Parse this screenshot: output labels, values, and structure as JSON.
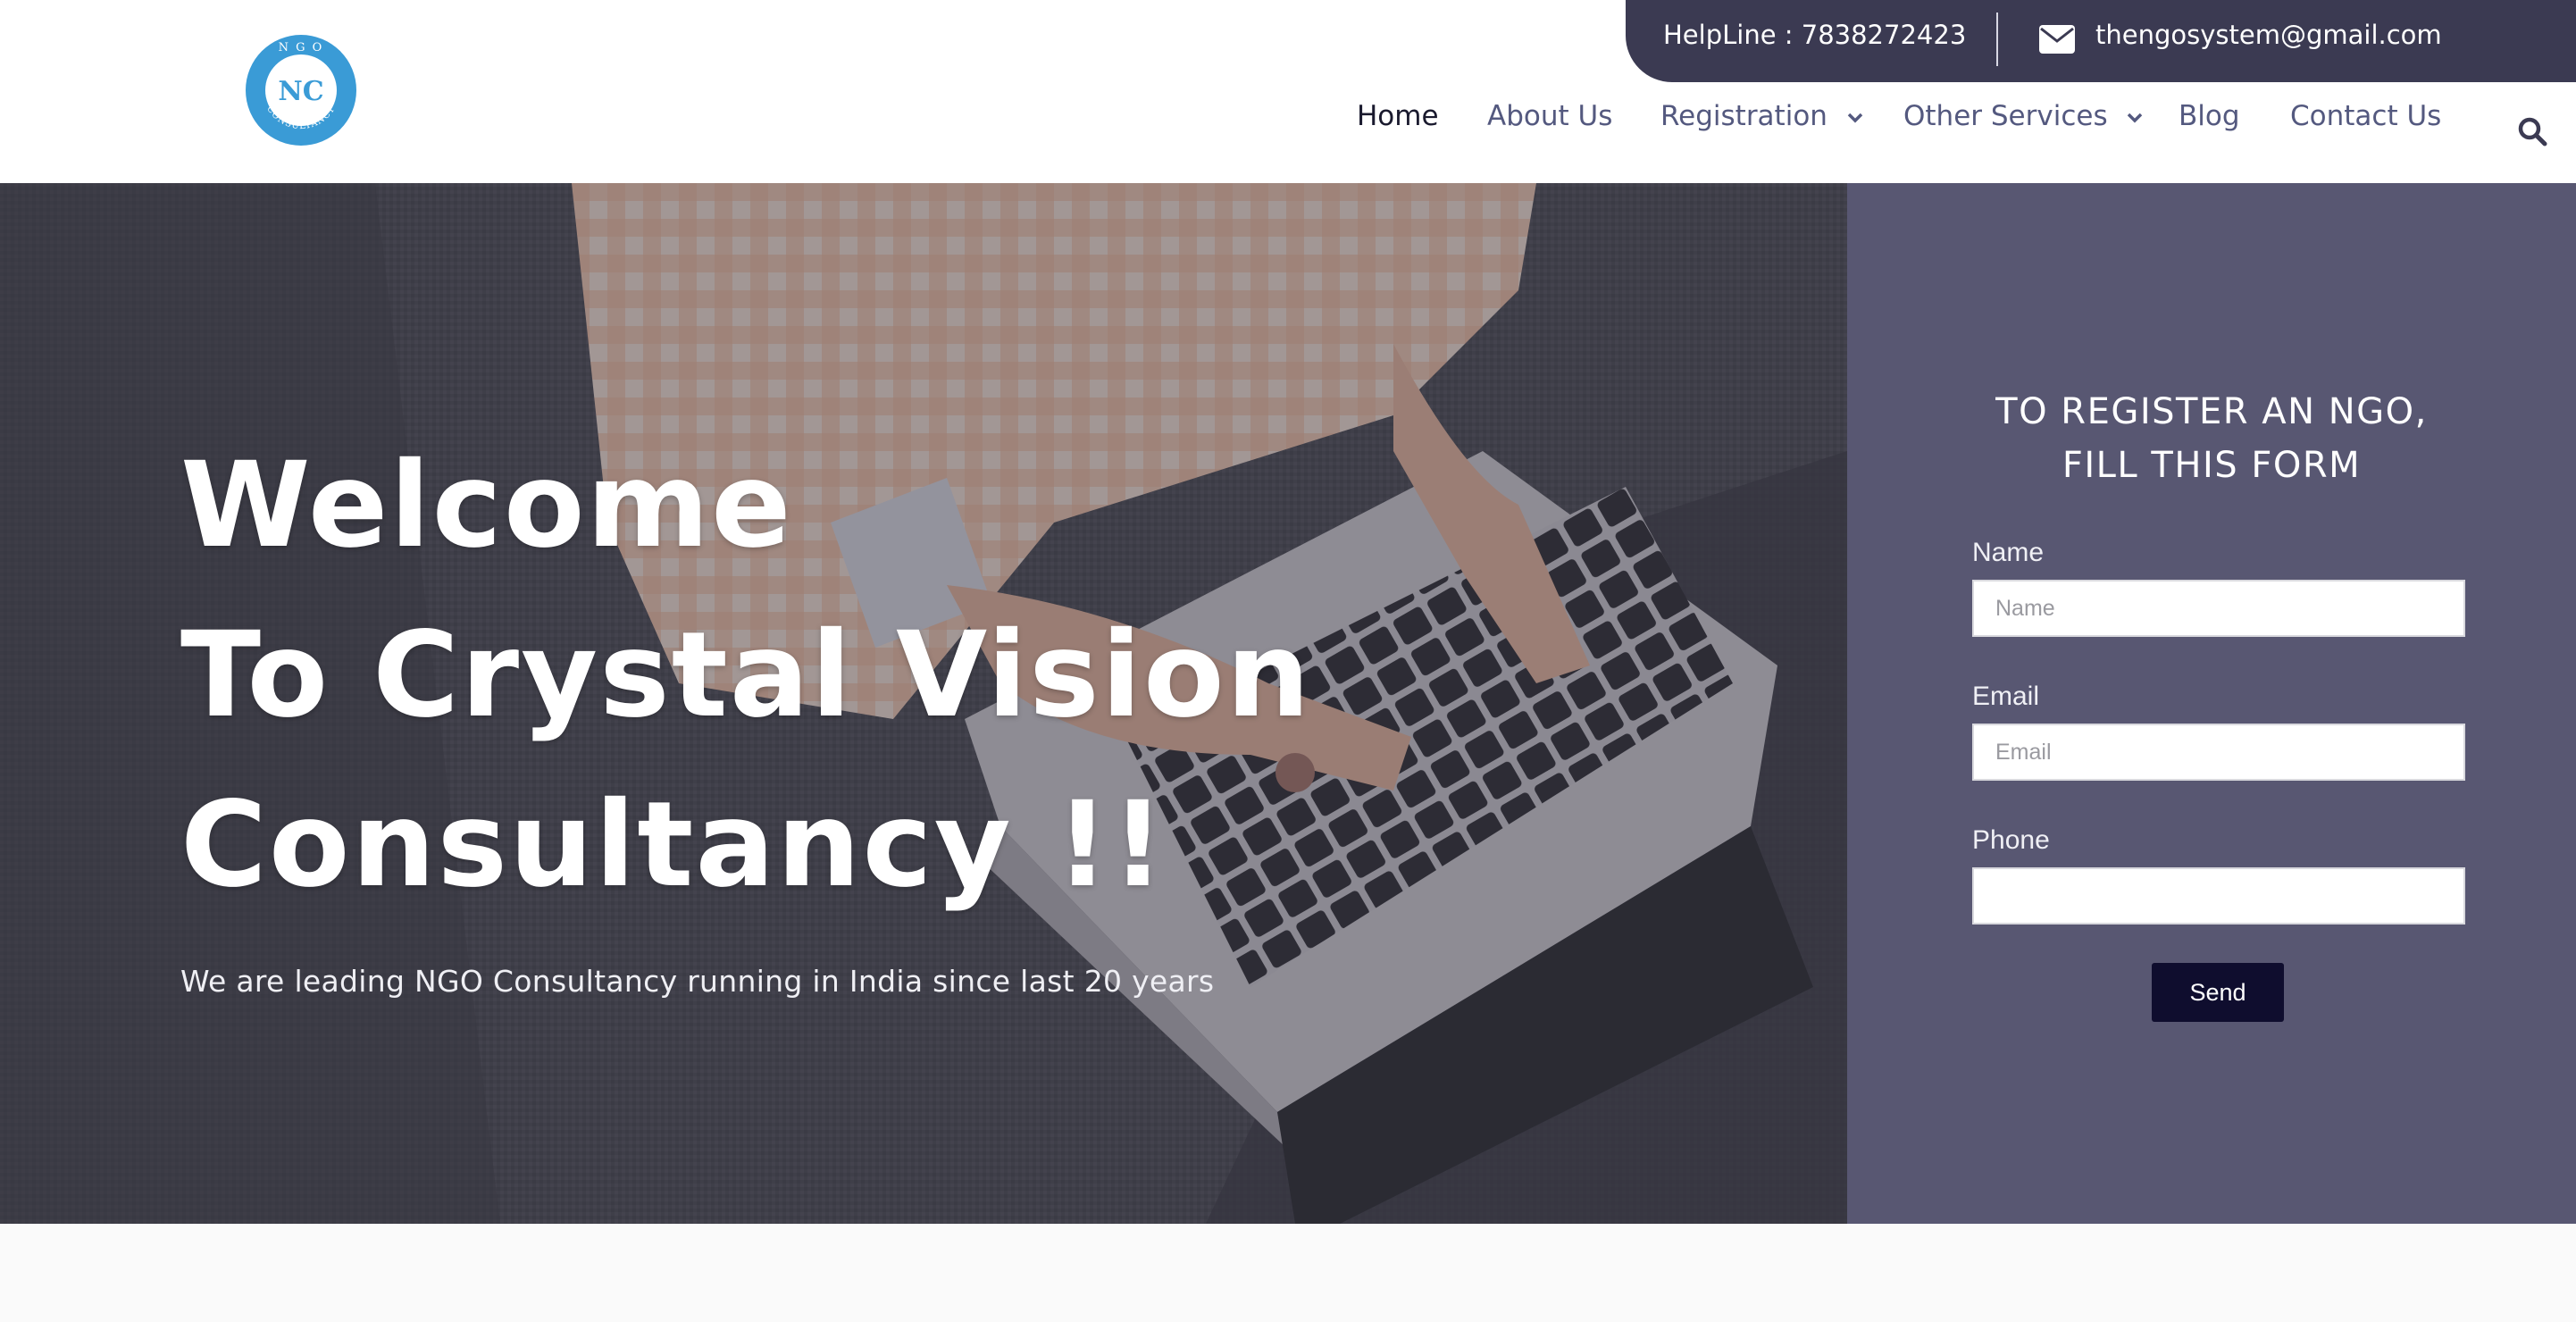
{
  "logo": {
    "top_text": "N G O",
    "monogram": "NC",
    "ring_text": "CONSULTANCY"
  },
  "topbar": {
    "helpline": "HelpLine : 7838272423",
    "email": "thengosystem@gmail.com",
    "email_icon": "envelope-icon"
  },
  "nav": {
    "items": [
      {
        "label": "Home",
        "active": true,
        "dropdown": false
      },
      {
        "label": "About Us",
        "active": false,
        "dropdown": false
      },
      {
        "label": "Registration",
        "active": false,
        "dropdown": true
      },
      {
        "label": "Other Services",
        "active": false,
        "dropdown": true
      },
      {
        "label": "Blog",
        "active": false,
        "dropdown": false
      },
      {
        "label": "Contact Us",
        "active": false,
        "dropdown": false
      }
    ],
    "search_icon": "search-icon"
  },
  "hero": {
    "title_line1": "Welcome",
    "title_line2": "To Crystal Vision",
    "title_line3": "Consultancy !!",
    "subtitle": "We are leading NGO Consultancy running in India since last 20 years"
  },
  "form": {
    "title_line1": "TO REGISTER AN NGO,",
    "title_line2": "FILL THIS FORM",
    "name_label": "Name",
    "name_placeholder": "Name",
    "name_value": "",
    "email_label": "Email",
    "email_placeholder": "Email",
    "email_value": "",
    "phone_label": "Phone",
    "phone_placeholder": "",
    "phone_value": "",
    "send_label": "Send"
  },
  "colors": {
    "topbar_bg": "#3b3a52",
    "nav_text": "#54597f",
    "nav_active": "#1a1a2e",
    "form_panel_bg": "#585772",
    "send_button_bg": "#0f0d2e",
    "logo_blue": "#3a9bd6"
  }
}
